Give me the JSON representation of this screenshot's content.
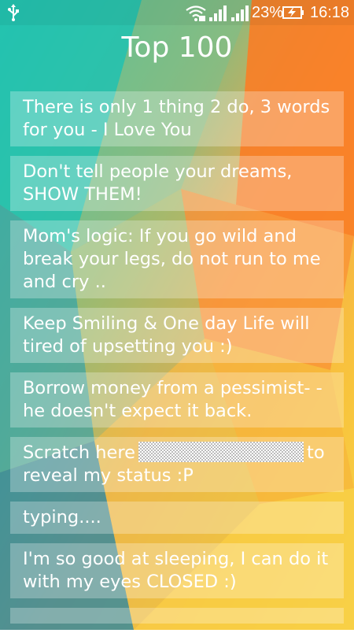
{
  "status_bar": {
    "battery_percent": "23%",
    "time": "16:18",
    "icons": [
      "usb-icon",
      "wifi-icon",
      "signal-icon",
      "signal-icon",
      "battery-charging-icon"
    ]
  },
  "header": {
    "title": "Top 100"
  },
  "statuses": [
    {
      "text": "There is only 1 thing 2 do, 3 words for you - I Love You"
    },
    {
      "text": "Don't tell people your dreams, SHOW THEM!"
    },
    {
      "text": "Mom's logic: If you go wild and break your legs, do not run to me and cry .."
    },
    {
      "text": "Keep Smiling & One day Life will tired of upsetting you :)"
    },
    {
      "text": "Borrow money from a pessimist- - he doesn't expect it back."
    },
    {
      "before": "Scratch here",
      "after": "to reveal my status :P"
    },
    {
      "text": "typing...."
    },
    {
      "text": "I'm so good at sleeping, I can do it with my eyes CLOSED :)"
    }
  ],
  "colors": {
    "teal": "#2fc2a6",
    "orange": "#f9812a",
    "yellow": "#f8c43c",
    "text": "#ffffff"
  }
}
